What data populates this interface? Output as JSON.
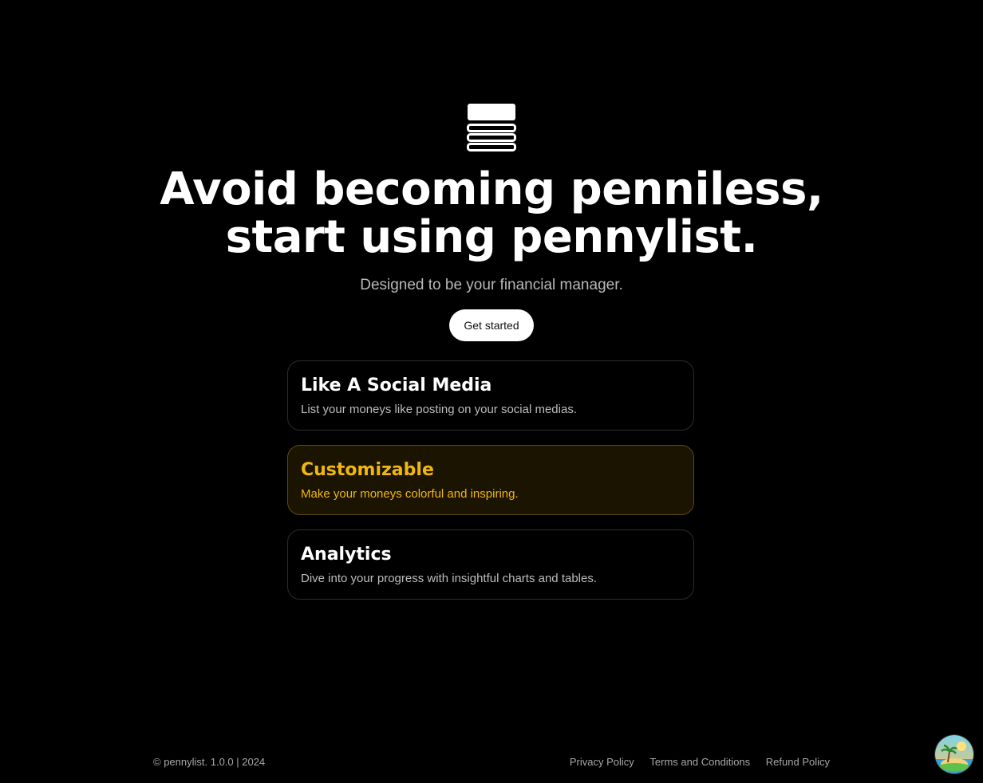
{
  "brand": {
    "logo_icon": "stacked-bars-logo-icon"
  },
  "hero": {
    "headline_line1": "Avoid becoming penniless,",
    "headline_line2": "start using pennylist.",
    "subtitle": "Designed to be your financial manager.",
    "cta_label": "Get started"
  },
  "features": [
    {
      "title": "Like A Social Media",
      "description": "List your moneys like posting on your social medias."
    },
    {
      "title": "Customizable",
      "description": "Make your moneys colorful and inspiring."
    },
    {
      "title": "Analytics",
      "description": "Dive into your progress with insightful charts and tables."
    }
  ],
  "footer": {
    "copyright": "© pennylist. 1.0.0 | 2024",
    "links": [
      "Privacy Policy",
      "Terms and Conditions",
      "Refund Policy"
    ]
  },
  "theme_button": {
    "icon": "island-sunset-icon"
  },
  "colors": {
    "background": "#000000",
    "text": "#ffffff",
    "muted": "#b9b9b9",
    "accent": "#f2b70f"
  }
}
